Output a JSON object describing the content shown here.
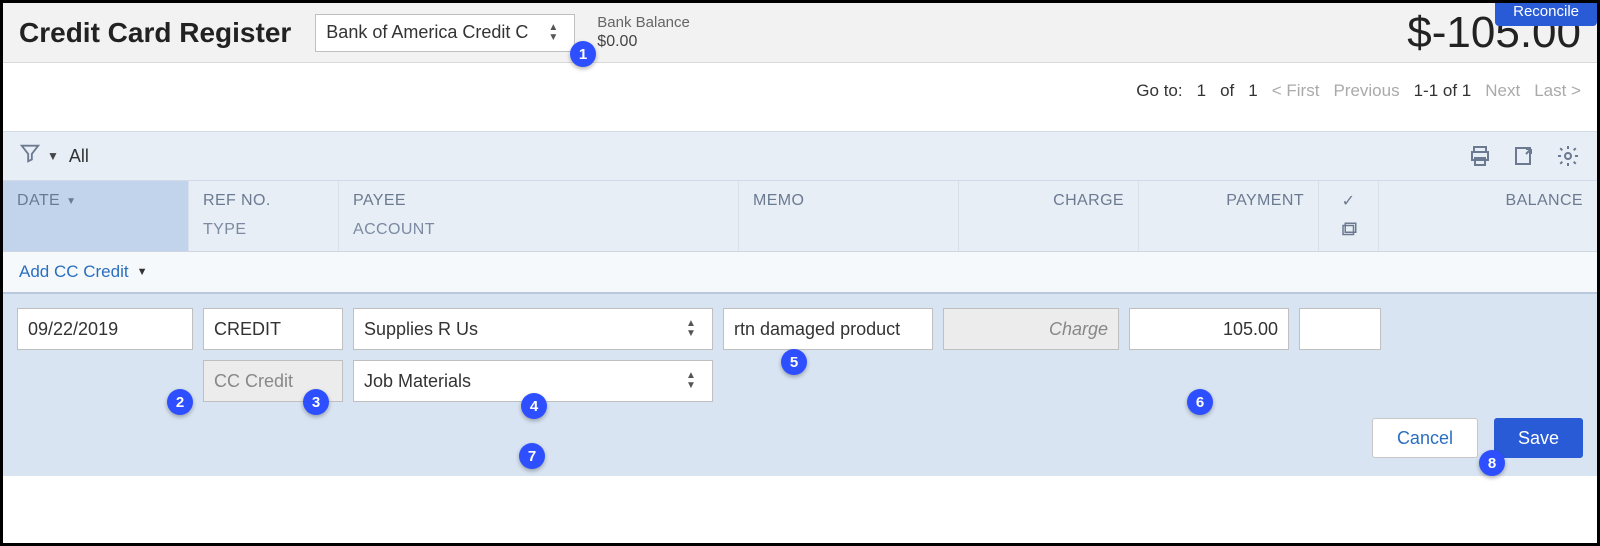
{
  "header": {
    "title": "Credit Card Register",
    "account_selected": "Bank of America Credit C",
    "bank_balance_label": "Bank Balance",
    "bank_balance_value": "$0.00",
    "running_balance": "$-105.00",
    "reconcile_label": "Reconcile"
  },
  "pagination": {
    "goto_label": "Go to:",
    "page": "1",
    "of_label": "of",
    "total_pages": "1",
    "first": "< First",
    "previous": "Previous",
    "range": "1-1 of 1",
    "next": "Next",
    "last": "Last >"
  },
  "filter": {
    "label": "All"
  },
  "columns": {
    "date": "DATE",
    "ref_no": "REF NO.",
    "type": "TYPE",
    "payee": "PAYEE",
    "account": "ACCOUNT",
    "memo": "MEMO",
    "charge": "CHARGE",
    "payment": "PAYMENT",
    "balance": "BALANCE"
  },
  "add_row": {
    "label": "Add CC Credit"
  },
  "entry": {
    "date": "09/22/2019",
    "ref": "CREDIT",
    "payee": "Supplies R Us",
    "memo": "rtn damaged product",
    "charge_placeholder": "Charge",
    "payment": "105.00",
    "type": "CC Credit",
    "account": "Job Materials"
  },
  "buttons": {
    "cancel": "Cancel",
    "save": "Save"
  },
  "badges": {
    "b1": "1",
    "b2": "2",
    "b3": "3",
    "b4": "4",
    "b5": "5",
    "b6": "6",
    "b7": "7",
    "b8": "8"
  }
}
